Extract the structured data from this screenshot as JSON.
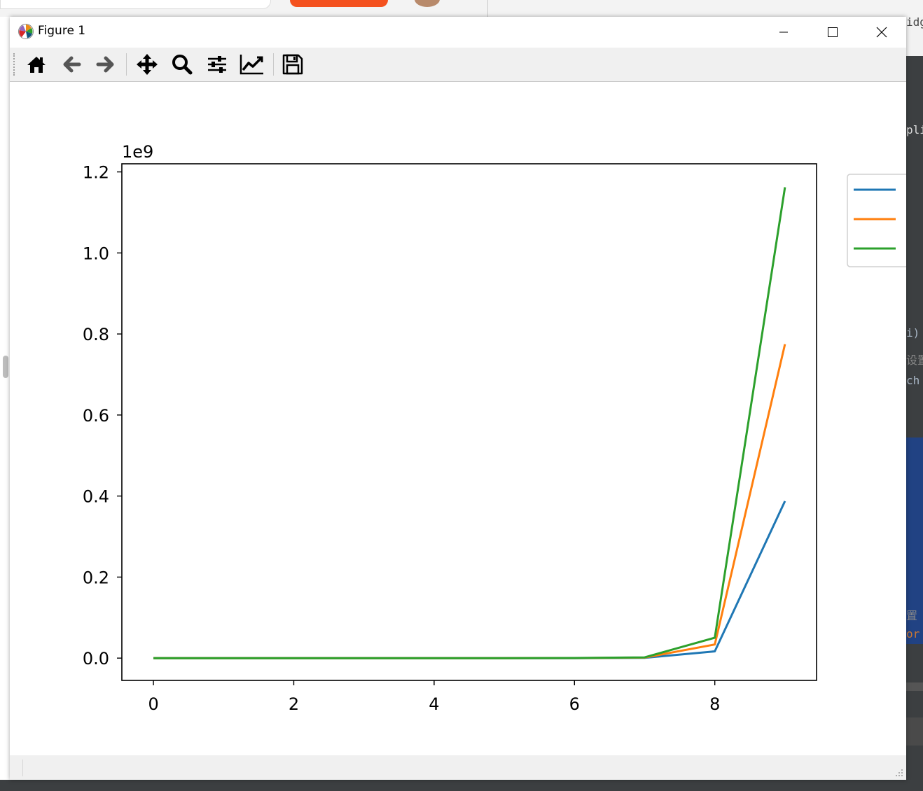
{
  "window": {
    "title": "Figure 1",
    "controls": [
      "minimize",
      "maximize",
      "close"
    ]
  },
  "toolbar": {
    "tools": [
      {
        "id": "home",
        "icon": "home-icon",
        "tooltip": "Home"
      },
      {
        "id": "back",
        "icon": "arrow-left-icon",
        "tooltip": "Back"
      },
      {
        "id": "forward",
        "icon": "arrow-right-icon",
        "tooltip": "Forward"
      },
      {
        "id": "pan",
        "icon": "move-icon",
        "tooltip": "Pan"
      },
      {
        "id": "zoom",
        "icon": "magnifier-icon",
        "tooltip": "Zoom"
      },
      {
        "id": "subplots",
        "icon": "sliders-icon",
        "tooltip": "Subplots"
      },
      {
        "id": "axes",
        "icon": "line-chart-icon",
        "tooltip": "Customize"
      },
      {
        "id": "save",
        "icon": "floppy-disk-icon",
        "tooltip": "Save"
      }
    ]
  },
  "chart_data": {
    "type": "line",
    "title": "",
    "xlabel": "",
    "ylabel": "",
    "offset_text": "1e9",
    "xlim": [
      -0.45,
      9.45
    ],
    "ylim": [
      -0.055,
      1.22
    ],
    "y_multiplier": 1000000000,
    "xticks": [
      0,
      2,
      4,
      6,
      8
    ],
    "xtick_labels": [
      "0",
      "2",
      "4",
      "6",
      "8"
    ],
    "yticks": [
      0.0,
      0.2,
      0.4,
      0.6,
      0.8,
      1.0,
      1.2
    ],
    "ytick_labels": [
      "0.0",
      "0.2",
      "0.4",
      "0.6",
      "0.8",
      "1.0",
      "1.2"
    ],
    "grid": false,
    "legend": "outside-right-top",
    "x": [
      0,
      1,
      2,
      3,
      4,
      5,
      6,
      7,
      8,
      9
    ],
    "series": [
      {
        "color": "#1f77b4",
        "values": [
          0,
          0,
          0,
          0,
          0,
          0,
          0,
          0.0006,
          0.0167,
          0.3874
        ]
      },
      {
        "color": "#ff7f0e",
        "values": [
          0,
          0,
          0,
          0,
          0,
          0,
          0.0001,
          0.0013,
          0.0336,
          0.7748
        ]
      },
      {
        "color": "#2ca02c",
        "values": [
          0,
          0,
          0,
          0,
          0,
          0,
          0.0002,
          0.0019,
          0.0504,
          1.1622
        ]
      }
    ]
  },
  "background": {
    "side_text": [
      "idg",
      "plie",
      "i)",
      "设置",
      "ch",
      "置",
      "or"
    ]
  }
}
